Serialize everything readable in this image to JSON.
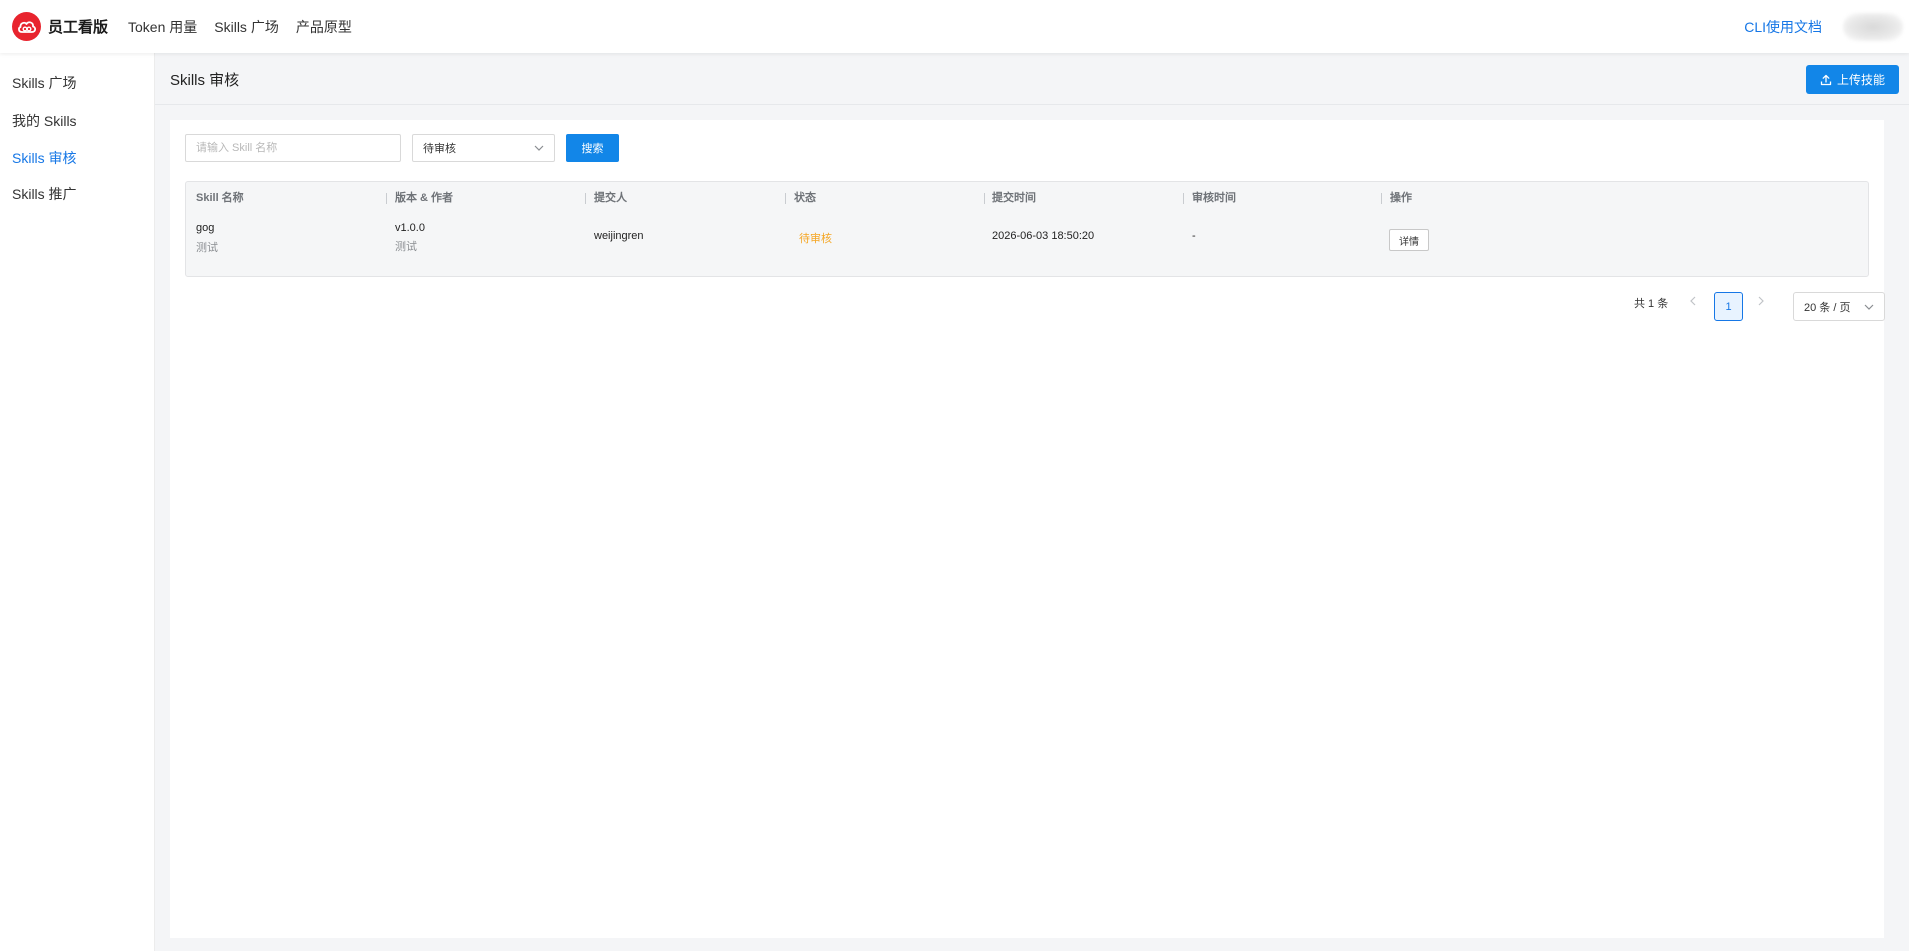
{
  "header": {
    "brand_title": "员工看版",
    "nav": [
      "Token 用量",
      "Skills 广场",
      "产品原型"
    ],
    "cli_doc": "CLI使用文档",
    "icons": {
      "logo": "cloud-logo-icon",
      "avatar": "user-avatar"
    }
  },
  "sidebar": {
    "items": [
      {
        "label": "Skills 广场",
        "active": false
      },
      {
        "label": "我的 Skills",
        "active": false
      },
      {
        "label": "Skills 审核",
        "active": true
      },
      {
        "label": "Skills 推广",
        "active": false
      }
    ]
  },
  "page": {
    "title": "Skills 审核",
    "upload_label": "上传技能",
    "upload_icon": "upload-icon"
  },
  "filters": {
    "search_placeholder": "请输入 Skill 名称",
    "status_value": "待审核",
    "search_label": "搜索"
  },
  "table": {
    "columns": [
      "Skill 名称",
      "版本 & 作者",
      "提交人",
      "状态",
      "提交时间",
      "审核时间",
      "操作"
    ],
    "rows": [
      {
        "name": "gog",
        "description": "测试",
        "version": "v1.0.0",
        "author": "测试",
        "submitter": "weijingren",
        "status": "待审核",
        "submit_time": "2026-06-03 18:50:20",
        "review_time": "-",
        "action": "详情"
      }
    ]
  },
  "pagination": {
    "total": "共 1 条",
    "current_page": "1",
    "page_size": "20 条 / 页"
  },
  "colors": {
    "accent": "#1677e6",
    "button": "#1286e8",
    "brand_red": "#e8242e",
    "pending": "#f5a623"
  }
}
